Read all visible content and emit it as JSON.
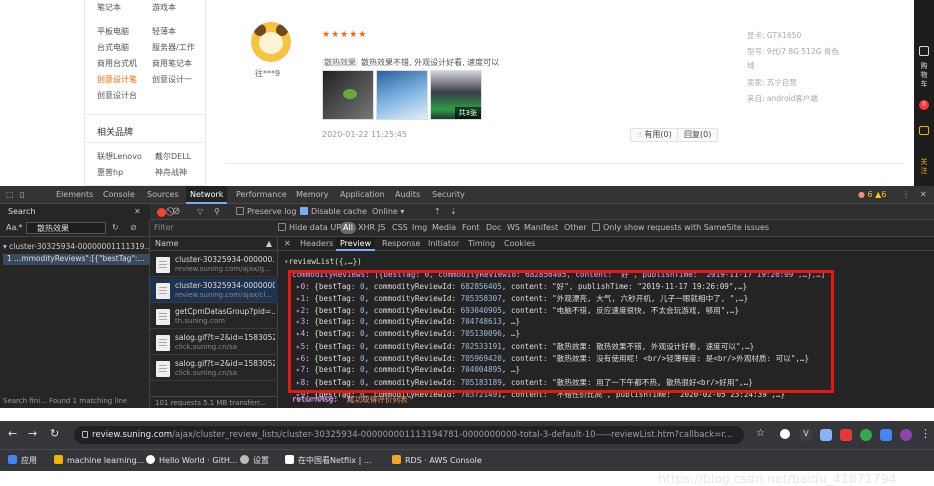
{
  "left_nav": {
    "rows": [
      [
        "平板电脑",
        "轻薄本"
      ],
      [
        "台式电脑",
        "服务器/工作"
      ],
      [
        "商用台式机",
        "商用笔记本"
      ],
      [
        "创意设计笔",
        "创意设计一"
      ],
      [
        "创意设计台",
        ""
      ]
    ],
    "related_brands_title": "相关品牌",
    "brands": [
      "联想Lenovo",
      "戴尔DELL",
      "惠普hp",
      "神舟战神"
    ]
  },
  "review": {
    "username": "往***9",
    "stars": "★★★★★",
    "tag": "散热效果",
    "text": "散热效果不错, 外观设计好看, 速度可以",
    "photo_count": "共3张",
    "date": "2020-01-22 11:25:45",
    "useful_label": "有用(0)",
    "reply_label": "回复(0)",
    "specs": [
      "显卡: GTX1650",
      "型号: 9代i7 8G 512G 青色",
      "域",
      "卖家: 苏宁自营",
      "来自: android客户端"
    ]
  },
  "side_toolbar": {
    "cart_label": "购物车",
    "cart_count": "0",
    "fav_label": "关注"
  },
  "devtools": {
    "tabs": [
      "Elements",
      "Console",
      "Sources",
      "Network",
      "Performance",
      "Memory",
      "Application",
      "Audits",
      "Security"
    ],
    "active_tab": "Network",
    "status": "6 ▲6",
    "search_label": "Search",
    "search_case": "Aa",
    "search_regex": ".*",
    "search_query": "散热效果",
    "search_result_file": "▾ cluster-30325934-00000001111319...",
    "search_result_line": "1   ...mmodityReviews\":[{\"bestTag\":...",
    "search_status": "Search fini... Found 1 matching line",
    "toolbar": {
      "preserve_log": "Preserve log",
      "disable_cache": "Disable cache",
      "throttle": "Online"
    },
    "filter": {
      "placeholder": "Filter",
      "hide_data_urls": "Hide data URLs",
      "all": "All",
      "types": [
        "XHR",
        "JS",
        "CSS",
        "Img",
        "Media",
        "Font",
        "Doc",
        "WS",
        "Manifest",
        "Other"
      ],
      "samesite": "Only show requests with SameSite issues"
    },
    "request_list": {
      "header": "Name",
      "rows": [
        {
          "name": "cluster-30325934-000000...",
          "domain": "review.suning.com/ajax/g..."
        },
        {
          "name": "cluster-30325934-0000000...",
          "domain": "review.suning.com/ajax/cl..."
        },
        {
          "name": "getCpmDatasGroup?pid=...",
          "domain": "th.suning.com"
        },
        {
          "name": "salog.gif?t=2&id=1583052...",
          "domain": "click.suning.cn/sa"
        },
        {
          "name": "salog.gif?t=2&id=1583052...",
          "domain": "click.suning.cn/sa"
        }
      ],
      "footer": "101 requests   5.1 MB transferr..."
    },
    "detail_tabs": [
      "Headers",
      "Preview",
      "Response",
      "Initiator",
      "Timing",
      "Cookies"
    ],
    "active_detail_tab": "Preview",
    "preview": {
      "root": "reviewList({,…})",
      "first_line": "commodityReviews: [{bestTag: 0, commodityReviewId: 682856405, content: \"好\", publishTime: \"2019-11-17 19:26:09\",…},…]",
      "items": [
        {
          "idx": "0",
          "id": "682856405",
          "rest": "content: \"好\", publishTime: \"2019-11-17 19:26:09\",…}"
        },
        {
          "idx": "1",
          "id": "705358307",
          "rest": "content: \"外观漂亮, 大气, 六秒开机, 儿子一眼就相中了, \",…}"
        },
        {
          "idx": "2",
          "id": "693040905",
          "rest": "content: \"电脑不错, 反应速度很快, 不太会玩游戏, 够用\",…}"
        },
        {
          "idx": "3",
          "id": "704748613",
          "rest": "…}"
        },
        {
          "idx": "4",
          "id": "705130096",
          "rest": "…}"
        },
        {
          "idx": "5",
          "id": "702533191",
          "rest": "content: \"散热效果: 散热效果不错, 外观设计好看, 速度可以\",…}"
        },
        {
          "idx": "6",
          "id": "705969420",
          "rest": "content: \"散热效果: 没有使用呢! <br/>轻薄程度: 是<br/>外观材质: 可以\",…}"
        },
        {
          "idx": "7",
          "id": "704004895",
          "rest": "…}"
        },
        {
          "idx": "8",
          "id": "705183189",
          "rest": "content: \"散热效果: 用了一下午都不热, 散热很好<br/>好用\",…}"
        },
        {
          "idx": "9",
          "id": "703721491",
          "rest": "content: \"不错性价比高\", publishTime: \"2020-02-05 23:24:39\",…}"
        }
      ],
      "return_code": "returnCode: \"1\"",
      "return_msg_key": "returnMsg:",
      "return_msg_value": "\"成功取得评价列表\""
    }
  },
  "browser": {
    "url_host": "review.suning.com",
    "url_path": "/ajax/cluster_review_lists/cluster-30325934-000000001113194781-0000000000-total-3-default-10-----reviewList.htm?callback=r...",
    "bookmarks": [
      "应用",
      "machine learning...",
      "Hello World · GitH...",
      "设置",
      "在中国看Netflix | ...",
      "RDS · AWS Console"
    ],
    "watermark": "https://blog.csdn.net/baidu_41871794"
  }
}
